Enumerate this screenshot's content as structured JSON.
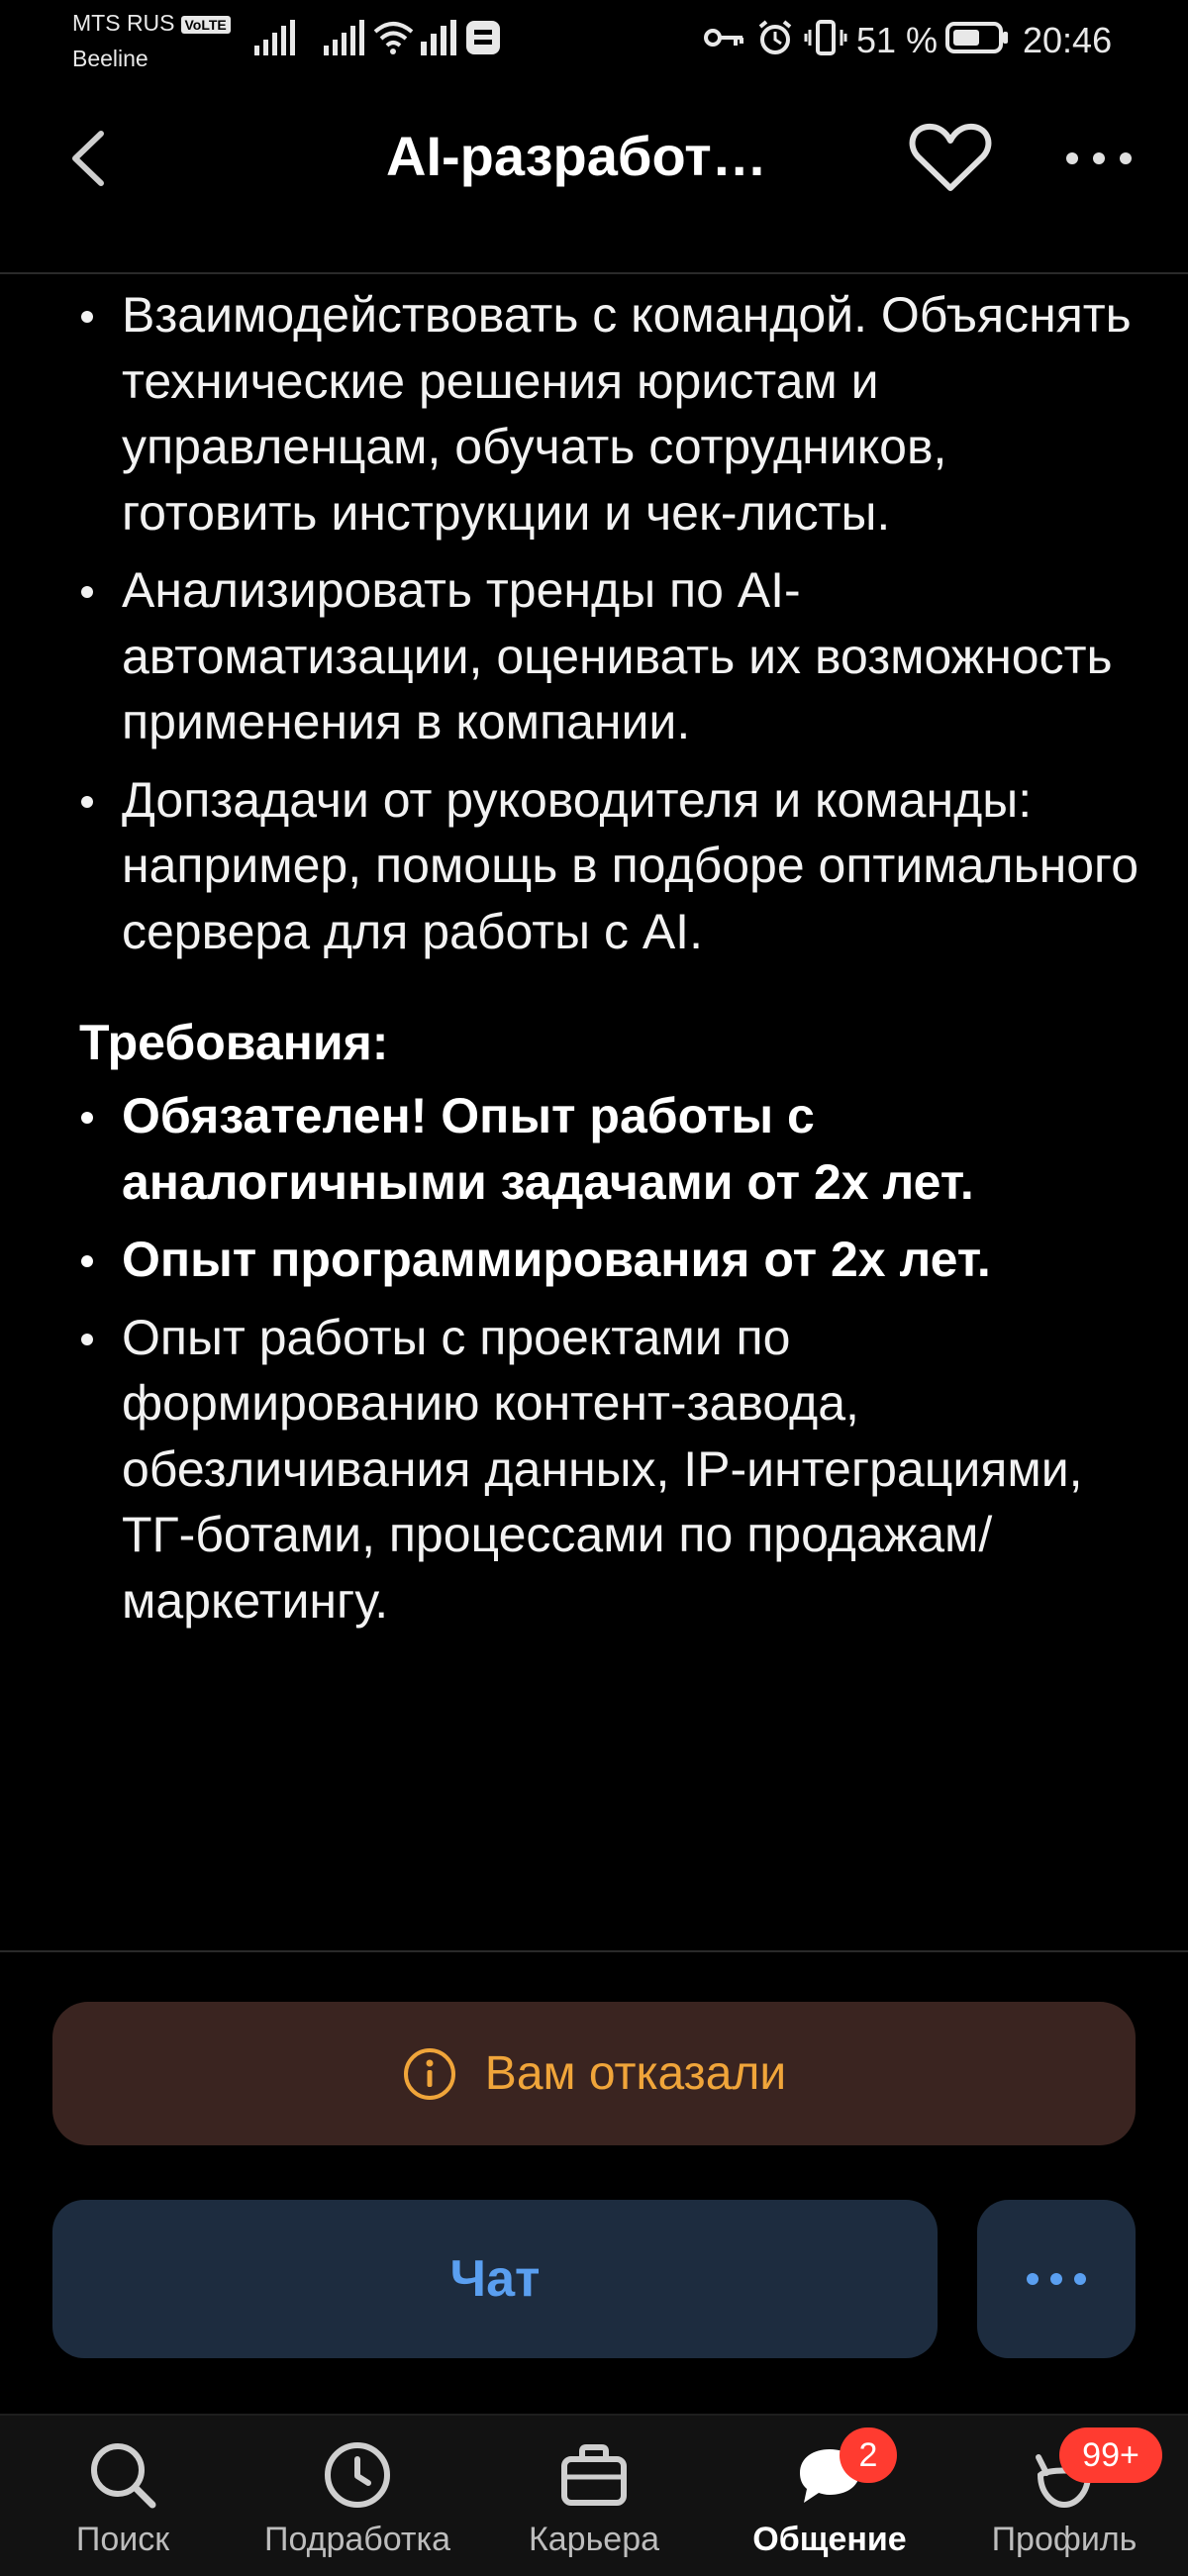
{
  "status_bar": {
    "carrier_1": "MTS RUS",
    "volte_badge": "VoLTE",
    "carrier_2": "Beeline",
    "battery_percent": "51 %",
    "time": "20:46"
  },
  "header": {
    "title": "AI-разработ…"
  },
  "content": {
    "items_a": [
      "Взаимодействовать с командой. Объяснять технические решения юристам и управленцам, обучать сотрудников, готовить инструкции и чек-листы.",
      "Анализировать тренды по AI-автоматизации, оценивать их возможность применения в компании.",
      "Допзадачи от руководителя и команды: например, помощь в подборе оптимального сервера для работы с AI."
    ],
    "requirements_heading": "Требования:",
    "requirements": [
      "Обязателен! Опыт работы с аналогичными задачами от 2х лет.",
      "Опыт программирования от 2х лет.",
      "Опыт работы с проектами по формированию контент-завода, обезличивания данных, IP-интеграциями, ТГ-ботами, процессами по продажам/маркетингу."
    ]
  },
  "status_banner": {
    "text": "Вам отказали",
    "color": "#f0a53a",
    "background": "#3a2420"
  },
  "actions": {
    "chat_label": "Чат",
    "accent": "#5a9ff0"
  },
  "bottom_nav": {
    "items": [
      {
        "label": "Поиск",
        "icon": "search-icon"
      },
      {
        "label": "Подработка",
        "icon": "clock-icon"
      },
      {
        "label": "Карьера",
        "icon": "briefcase-icon"
      },
      {
        "label": "Общение",
        "icon": "chat-bubble-icon",
        "badge": "2",
        "active": true
      },
      {
        "label": "Профиль",
        "icon": "profile-cat-icon",
        "badge": "99+"
      }
    ]
  }
}
